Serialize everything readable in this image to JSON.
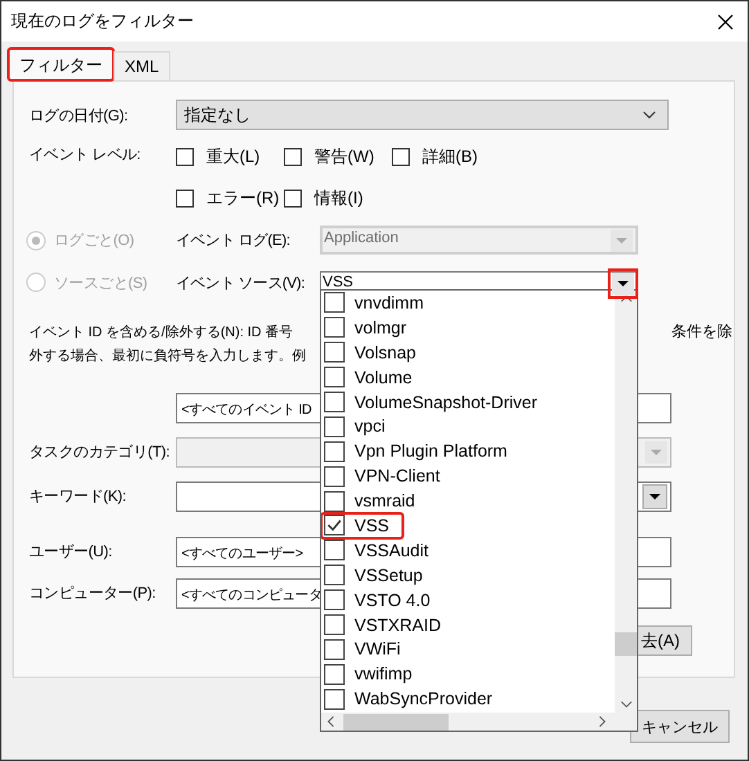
{
  "window": {
    "title": "現在のログをフィルター"
  },
  "tabs": [
    {
      "label": "フィルター",
      "selected": true,
      "highlighted": true
    },
    {
      "label": "XML",
      "selected": false,
      "highlighted": false
    }
  ],
  "log_date": {
    "label": "ログの日付(G):",
    "value": "指定なし"
  },
  "event_level": {
    "label": "イベント レベル:",
    "rows": [
      [
        {
          "label": "重大(L)",
          "checked": false
        },
        {
          "label": "警告(W)",
          "checked": false
        },
        {
          "label": "詳細(B)",
          "checked": false
        }
      ],
      [
        {
          "label": "エラー(R)",
          "checked": false
        },
        {
          "label": "情報(I)",
          "checked": false
        }
      ]
    ]
  },
  "scope": [
    {
      "label": "ログごと(O)",
      "selected": true,
      "disabled": true,
      "field_label": "イベント ログ(E):",
      "value": "Application",
      "field_disabled": true,
      "arrow_highlighted": false
    },
    {
      "label": "ソースごと(S)",
      "selected": false,
      "disabled": true,
      "field_label": "イベント ソース(V):",
      "value": "VSS",
      "field_disabled": false,
      "arrow_highlighted": true
    }
  ],
  "event_id": {
    "description_left": [
      "イベント ID を含める/除外する(N): ID 番号",
      "外する場合、最初に負符号を入力します。例"
    ],
    "description_right": "条件を除",
    "value": "<すべてのイベント ID"
  },
  "task_category": {
    "label": "タスクのカテゴリ(T):",
    "disabled": true
  },
  "keyword": {
    "label": "キーワード(K):"
  },
  "user": {
    "label": "ユーザー(U):",
    "value": "<すべてのユーザー>"
  },
  "computer": {
    "label": "コンピューター(P):",
    "value": "<すべてのコンピュータ"
  },
  "clear_button": "去(A)",
  "source_list": {
    "items": [
      {
        "label": "vnvdimm",
        "checked": false,
        "highlighted": false
      },
      {
        "label": "volmgr",
        "checked": false,
        "highlighted": false
      },
      {
        "label": "Volsnap",
        "checked": false,
        "highlighted": false
      },
      {
        "label": "Volume",
        "checked": false,
        "highlighted": false
      },
      {
        "label": "VolumeSnapshot-Driver",
        "checked": false,
        "highlighted": false
      },
      {
        "label": "vpci",
        "checked": false,
        "highlighted": false
      },
      {
        "label": "Vpn Plugin Platform",
        "checked": false,
        "highlighted": false
      },
      {
        "label": "VPN-Client",
        "checked": false,
        "highlighted": false
      },
      {
        "label": "vsmraid",
        "checked": false,
        "highlighted": false
      },
      {
        "label": "VSS",
        "checked": true,
        "highlighted": true
      },
      {
        "label": "VSSAudit",
        "checked": false,
        "highlighted": false
      },
      {
        "label": "VSSetup",
        "checked": false,
        "highlighted": false
      },
      {
        "label": "VSTO 4.0",
        "checked": false,
        "highlighted": false
      },
      {
        "label": "VSTXRAID",
        "checked": false,
        "highlighted": false
      },
      {
        "label": "VWiFi",
        "checked": false,
        "highlighted": false
      },
      {
        "label": "vwifimp",
        "checked": false,
        "highlighted": false
      },
      {
        "label": "WabSyncProvider",
        "checked": false,
        "highlighted": false
      }
    ]
  },
  "cancel_button": "キャンセル"
}
